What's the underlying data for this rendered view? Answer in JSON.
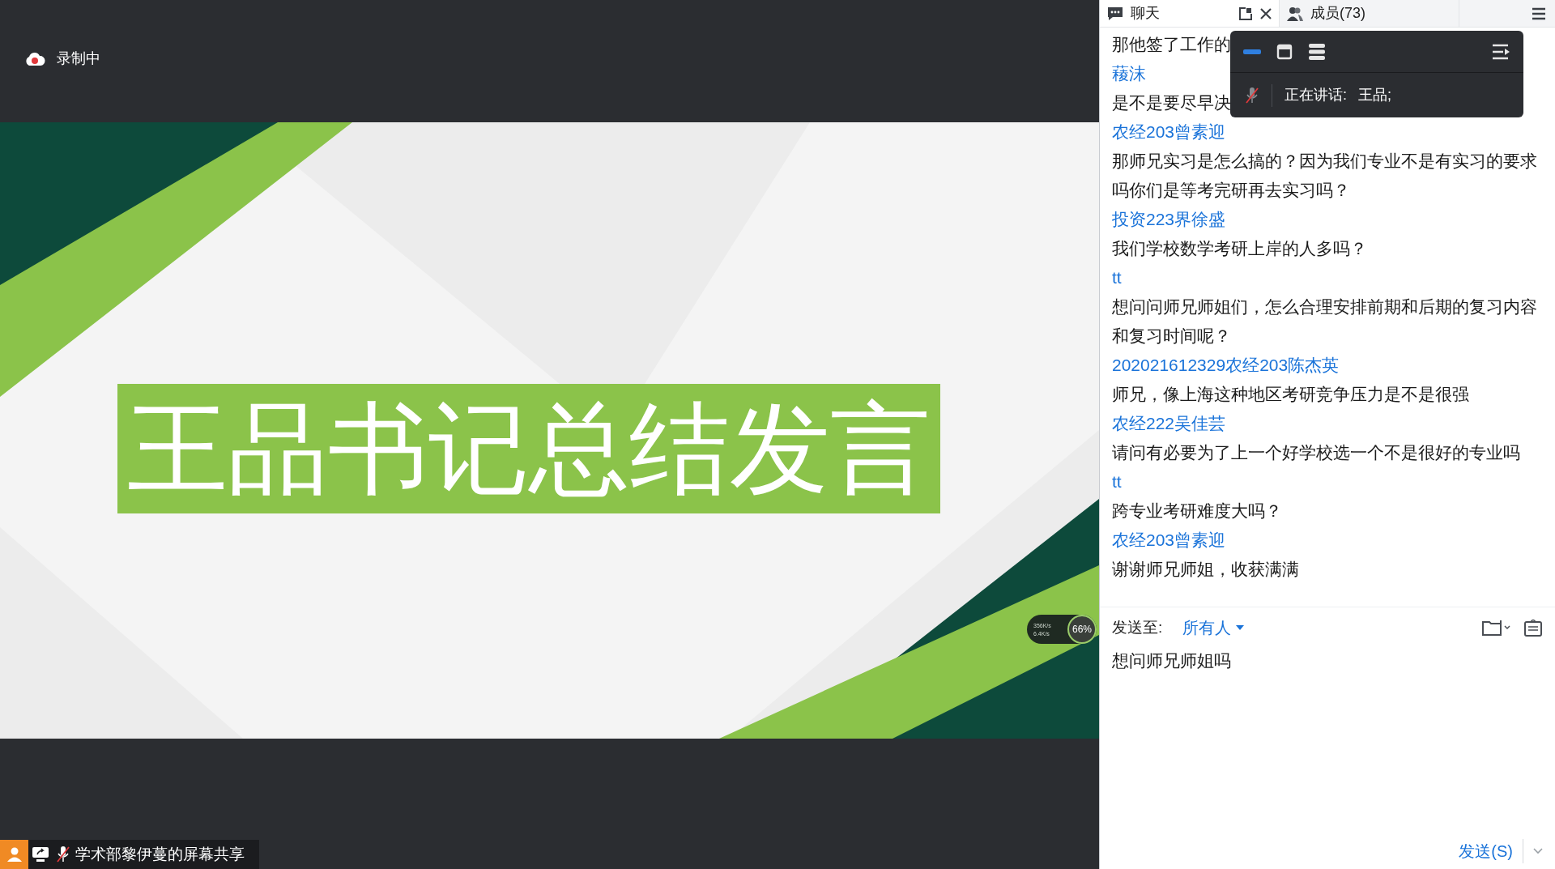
{
  "recording": {
    "label": "录制中",
    "active": true
  },
  "slide": {
    "title": "王品书记总结发言"
  },
  "network_widget": {
    "upload": "356K/s",
    "download": "6.4K/s",
    "load": "66%"
  },
  "share_bar": {
    "label": "学术部黎伊蔓的屏幕共享",
    "mic_muted": true
  },
  "chat_panel": {
    "tabs": [
      {
        "label": "聊天",
        "selected": true
      },
      {
        "label": "成员(73)",
        "selected": false
      }
    ],
    "messages": [
      {
        "kind": "text",
        "text": "那他签了工作的"
      },
      {
        "kind": "sender",
        "text": "薐沫"
      },
      {
        "kind": "text",
        "text": "是不是要尽早决"
      },
      {
        "kind": "sender",
        "text": "农经203曾素迎"
      },
      {
        "kind": "text",
        "text": "那师兄实习是怎么搞的？因为我们专业不是有实习的要求吗你们是等考完研再去实习吗？"
      },
      {
        "kind": "sender",
        "text": "投资223界徐盛"
      },
      {
        "kind": "text",
        "text": "我们学校数学考研上岸的人多吗？"
      },
      {
        "kind": "sender",
        "text": "tt"
      },
      {
        "kind": "text",
        "text": "想问问师兄师姐们，怎么合理安排前期和后期的复习内容和复习时间呢？"
      },
      {
        "kind": "sender",
        "text": "202021612329农经203陈杰英"
      },
      {
        "kind": "text",
        "text": "师兄，像上海这种地区考研竞争压力是不是很强"
      },
      {
        "kind": "sender",
        "text": "农经222吴佳芸"
      },
      {
        "kind": "text",
        "text": "请问有必要为了上一个好学校选一个不是很好的专业吗"
      },
      {
        "kind": "sender",
        "text": "tt"
      },
      {
        "kind": "text",
        "text": "跨专业考研难度大吗？"
      },
      {
        "kind": "sender",
        "text": "农经203曾素迎"
      },
      {
        "kind": "text",
        "text": "谢谢师兄师姐，收获满满"
      }
    ],
    "speaking_popup": {
      "layouts": [
        {
          "kind": "strip",
          "selected": true
        },
        {
          "kind": "window",
          "selected": false
        },
        {
          "kind": "list",
          "selected": false
        }
      ],
      "mic_muted": true,
      "label": "正在讲话:",
      "speaker": "王品;"
    },
    "send_to": {
      "label": "发送至:",
      "target": "所有人"
    },
    "input": {
      "value": "想问师兄师姐吗"
    },
    "send_button": "发送(S)"
  }
}
